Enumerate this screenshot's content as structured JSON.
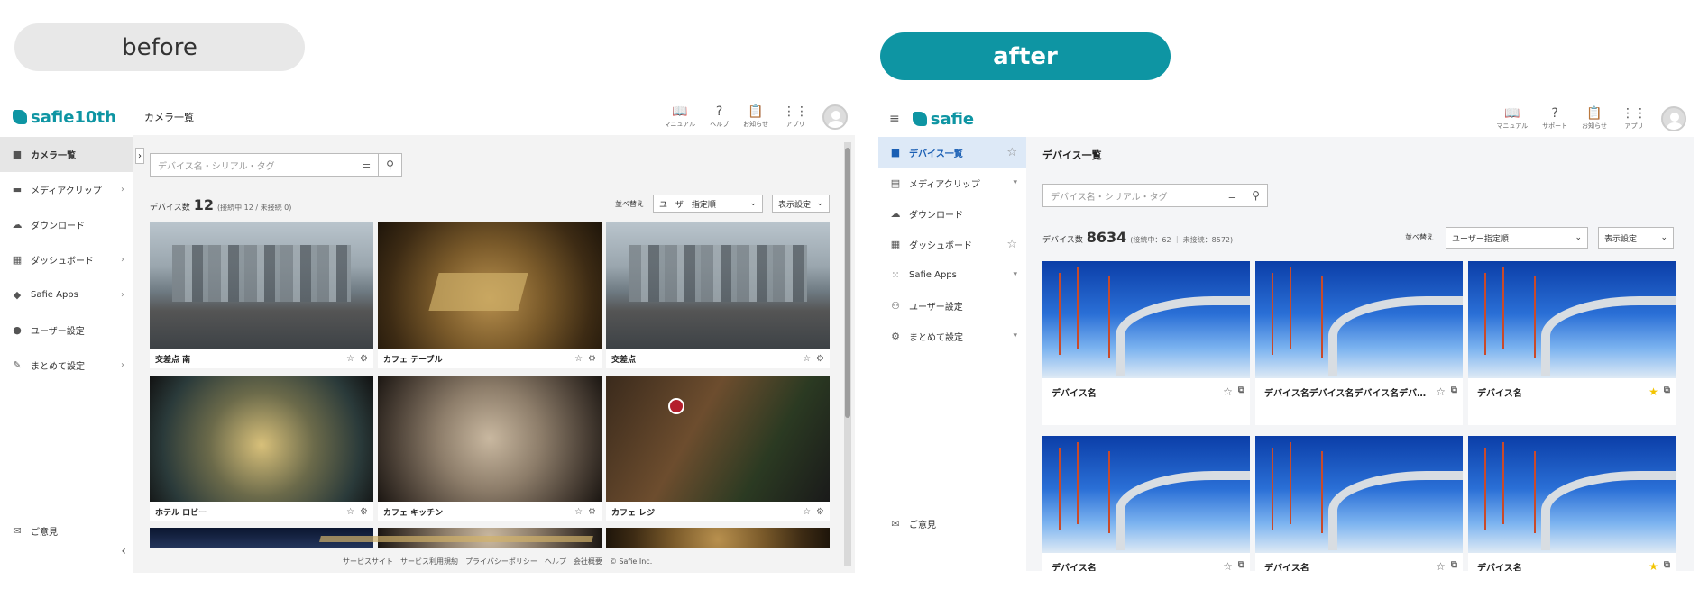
{
  "labels": {
    "before": "before",
    "after": "after"
  },
  "before": {
    "logo": "safie10th",
    "page_title": "カメラ一覧",
    "top_icons": [
      {
        "name": "manual-icon",
        "glyph": "📖",
        "label": "マニュアル"
      },
      {
        "name": "help-icon",
        "glyph": "?",
        "label": "ヘルプ"
      },
      {
        "name": "notice-icon",
        "glyph": "📋",
        "label": "お知らせ"
      },
      {
        "name": "apps-icon",
        "glyph": "⋮⋮",
        "label": "アプリ"
      }
    ],
    "nav": [
      {
        "icon": "camera-icon",
        "glyph": "■",
        "label": "カメラ一覧",
        "chev": ""
      },
      {
        "icon": "media-clip-icon",
        "glyph": "▬",
        "label": "メディアクリップ",
        "chev": "›"
      },
      {
        "icon": "cloud-download-icon",
        "glyph": "☁",
        "label": "ダウンロード",
        "chev": ""
      },
      {
        "icon": "dashboard-icon",
        "glyph": "▦",
        "label": "ダッシュボード",
        "chev": "›"
      },
      {
        "icon": "safie-apps-icon",
        "glyph": "◆",
        "label": "Safie Apps",
        "chev": "›"
      },
      {
        "icon": "user-icon",
        "glyph": "●",
        "label": "ユーザー設定",
        "chev": ""
      },
      {
        "icon": "wrench-icon",
        "glyph": "✎",
        "label": "まとめて設定",
        "chev": "›"
      }
    ],
    "feedback": "ご意見",
    "search_placeholder": "デバイス名・シリアル・タグ",
    "count_label": "デバイス数",
    "count": "12",
    "count_sub": "(接続中 12 / 未接続 0)",
    "sort_label": "並べ替え",
    "sort_value": "ユーザー指定順",
    "display_label": "表示設定",
    "cameras": [
      {
        "name": "交差点 南",
        "thumb": "city"
      },
      {
        "name": "カフェ テーブル",
        "thumb": "cafe"
      },
      {
        "name": "交差点",
        "thumb": "city"
      },
      {
        "name": "ホテル ロビー",
        "thumb": "lobby"
      },
      {
        "name": "カフェ キッチン",
        "thumb": "kitchen"
      },
      {
        "name": "カフェ レジ",
        "thumb": "register"
      }
    ],
    "footer": "サービスサイト　サービス利用規約　プライバシーポリシー　ヘルプ　会社概要　© Safie Inc."
  },
  "after": {
    "logo": "safie",
    "top_icons": [
      {
        "name": "manual-icon",
        "glyph": "📖",
        "label": "マニュアル"
      },
      {
        "name": "support-icon",
        "glyph": "?",
        "label": "サポート"
      },
      {
        "name": "notice-icon",
        "glyph": "📋",
        "label": "お知らせ"
      },
      {
        "name": "apps-icon",
        "glyph": "⋮⋮",
        "label": "アプリ"
      }
    ],
    "nav": [
      {
        "icon": "camera-icon",
        "glyph": "■",
        "label": "デバイス一覧",
        "right": "☆"
      },
      {
        "icon": "media-clip-icon",
        "glyph": "▤",
        "label": "メディアクリップ",
        "right": "▾"
      },
      {
        "icon": "cloud-download-icon",
        "glyph": "☁",
        "label": "ダウンロード",
        "right": ""
      },
      {
        "icon": "dashboard-icon",
        "glyph": "▦",
        "label": "ダッシュボード",
        "right": "☆"
      },
      {
        "icon": "safie-apps-icon",
        "glyph": "⁙",
        "label": "Safie Apps",
        "right": "▾"
      },
      {
        "icon": "user-settings-icon",
        "glyph": "⚇",
        "label": "ユーザー設定",
        "right": ""
      },
      {
        "icon": "gear-icon",
        "glyph": "⚙",
        "label": "まとめて設定",
        "right": "▾"
      }
    ],
    "feedback": "ご意見",
    "page_title": "デバイス一覧",
    "search_placeholder": "デバイス名・シリアル・タグ",
    "count_label": "デバイス数",
    "count": "8634",
    "count_sub": "(接続中：62 ｜ 未接続：8572)",
    "sort_label": "並べ替え",
    "sort_value": "ユーザー指定順",
    "display_label": "表示設定",
    "devices": [
      {
        "name": "デバイス名",
        "starred": false
      },
      {
        "name": "デバイス名デバイス名デバイス名デバイス名",
        "starred": false
      },
      {
        "name": "デバイス名",
        "starred": true
      },
      {
        "name": "デバイス名",
        "starred": false
      },
      {
        "name": "デバイス名",
        "starred": false
      },
      {
        "name": "デバイス名",
        "starred": true
      }
    ]
  }
}
